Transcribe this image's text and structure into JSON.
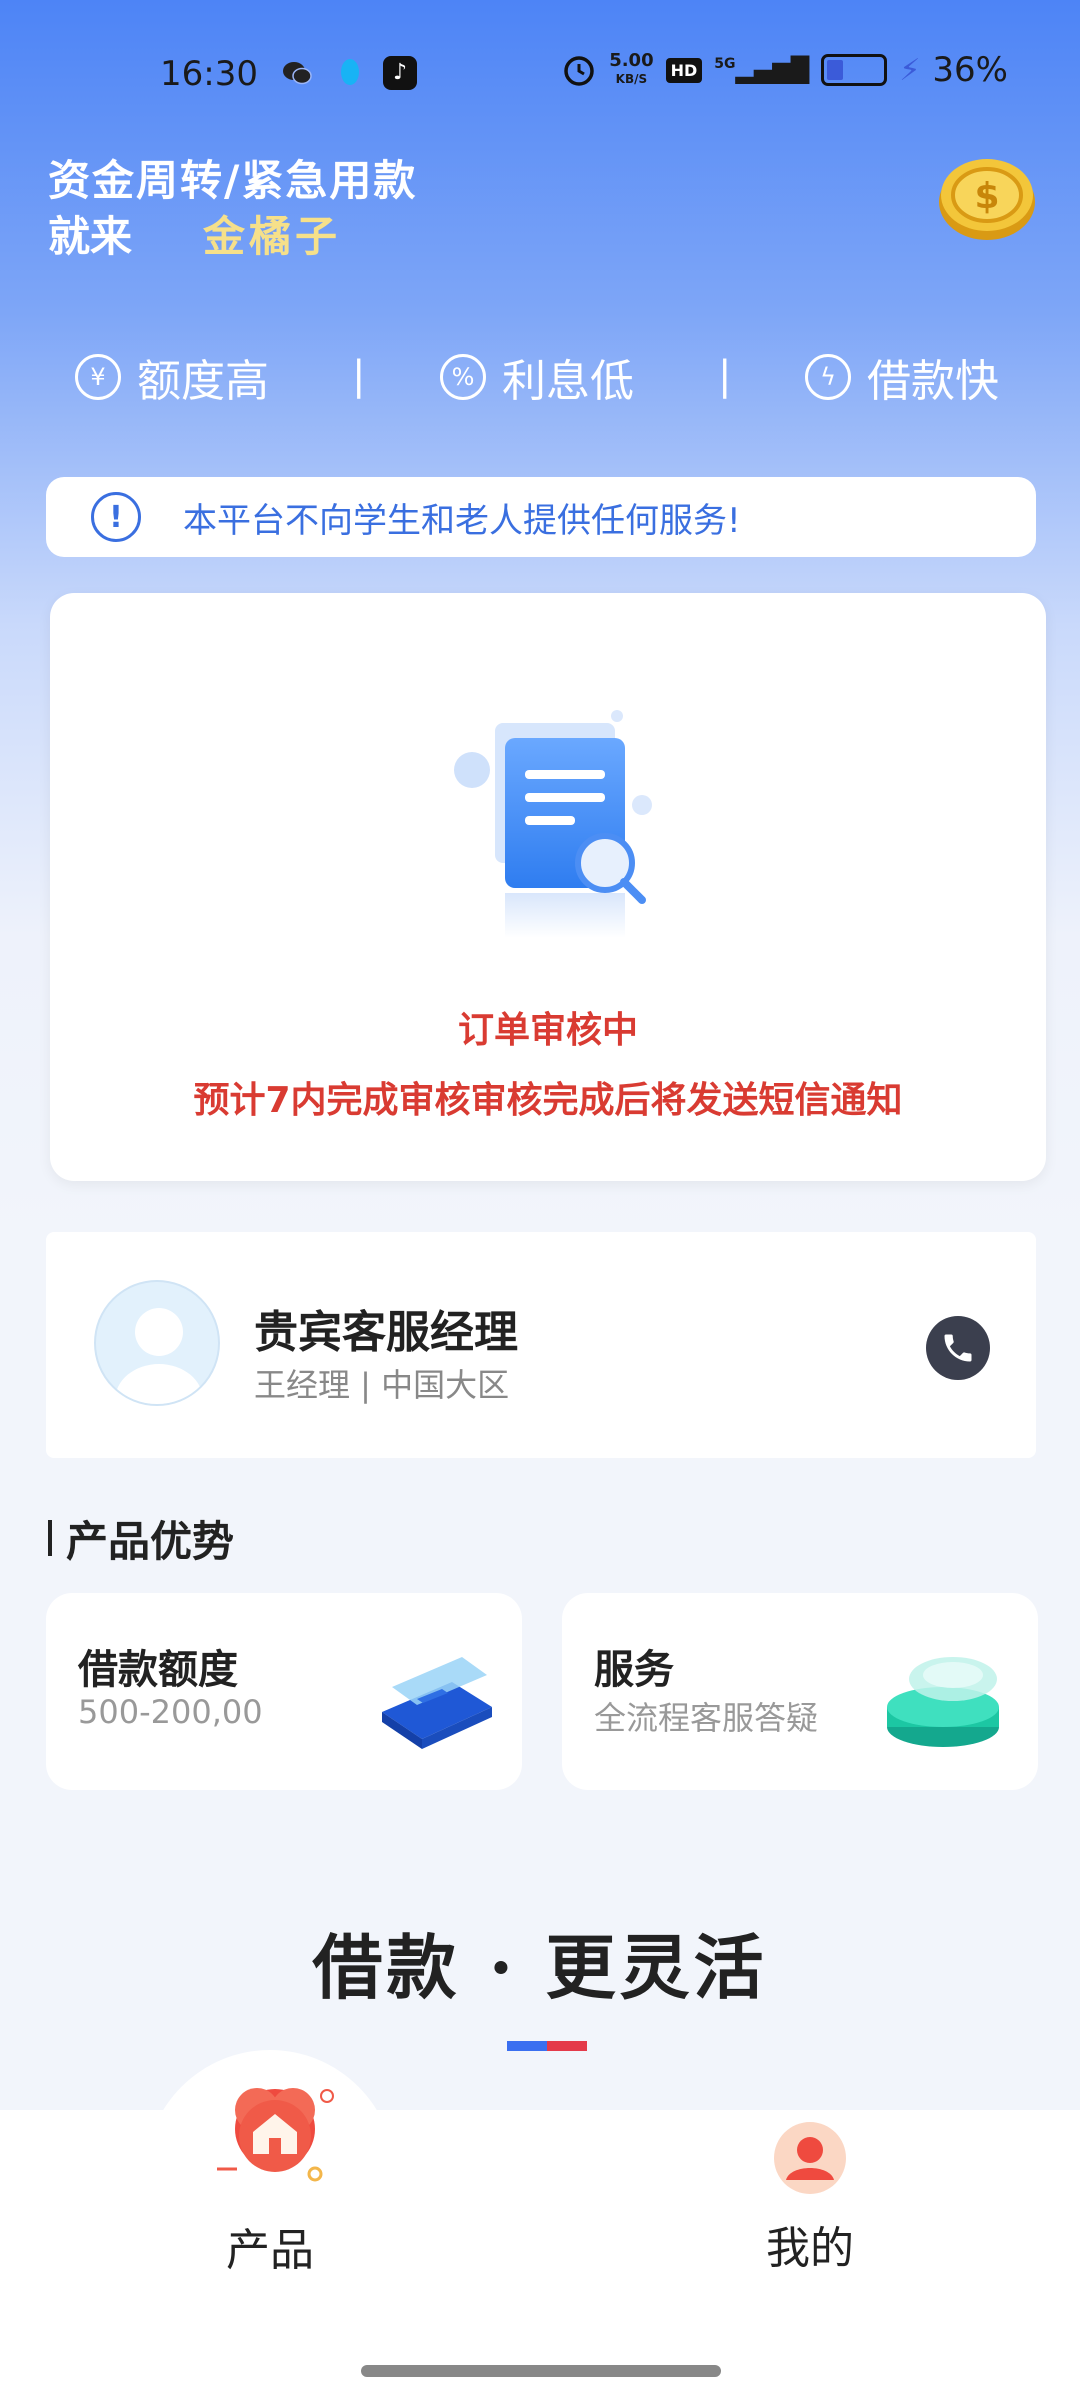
{
  "status_bar": {
    "time": "16:30",
    "speed_value": "5.00",
    "speed_unit": "KB/S",
    "hd_badge": "HD",
    "network": "5G",
    "battery_level": 0.36,
    "battery_percent": "36%"
  },
  "header": {
    "line1": "资金周转/紧急用款",
    "line2": "就来",
    "brand": "金橘子"
  },
  "features": [
    {
      "label": "额度高",
      "icon": "money-bag-icon"
    },
    {
      "label": "利息低",
      "icon": "percent-icon"
    },
    {
      "label": "借款快",
      "icon": "lightning-icon"
    }
  ],
  "separator": "|",
  "notice": {
    "text": "本平台不向学生和老人提供任何服务!",
    "icon_char": "!"
  },
  "review": {
    "title": "订单审核中",
    "description": "预计7内完成审核审核完成后将发送短信通知"
  },
  "manager": {
    "title": "贵宾客服经理",
    "subtitle": "王经理 | 中国大区"
  },
  "advantages": {
    "section_title": "产品优势",
    "items": [
      {
        "title": "借款额度",
        "subtitle": "500-200,00"
      },
      {
        "title": "服务",
        "subtitle": "全流程客服答疑"
      }
    ]
  },
  "slogan": "借款 · 更灵活",
  "tabs": [
    {
      "label": "产品",
      "icon": "home-icon",
      "active": true
    },
    {
      "label": "我的",
      "icon": "user-icon",
      "active": false
    }
  ],
  "colors": {
    "primary": "#4d84f6",
    "accent_gold": "#f6e08a",
    "alert_red": "#d93b32",
    "link_blue": "#3a6fe0"
  }
}
